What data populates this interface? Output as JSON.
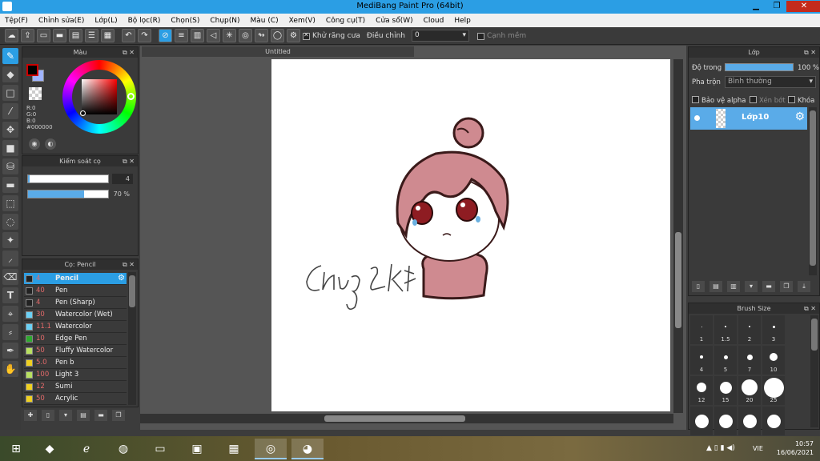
{
  "window": {
    "title": "MediBang Paint Pro (64bit)",
    "minimize": "▁",
    "maximize": "❐",
    "close": "✕"
  },
  "menu": [
    "Tệp(F)",
    "Chỉnh sửa(E)",
    "Lớp(L)",
    "Bộ lọc(R)",
    "Chọn(S)",
    "Chụp(N)",
    "Màu (C)",
    "Xem(V)",
    "Công cụ(T)",
    "Cửa sổ(W)",
    "Cloud",
    "Help"
  ],
  "toolbar": {
    "antialias_label": "Khử răng cưa",
    "antialias_checked": true,
    "correction_label": "Điều chỉnh",
    "correction_value": "0",
    "smooth_label": "Cạnh mềm",
    "smooth_checked": false
  },
  "color_panel": {
    "title": "Màu",
    "r": "R:0",
    "g": "G:0",
    "b": "B:0",
    "hex": "#000000",
    "primary": "#000000",
    "secondary": "#a0b4ff"
  },
  "brush_control": {
    "title": "Kiểm soát cọ",
    "size_value": "4",
    "size_fill": 0.02,
    "opacity_value": "70 %",
    "opacity_fill": 0.7
  },
  "brush_list": {
    "title": "Cọ: Pencil",
    "items": [
      {
        "size": "4",
        "name": "Pencil",
        "color": "#222222",
        "selected": true
      },
      {
        "size": "40",
        "name": "Pen",
        "color": "#222222"
      },
      {
        "size": "4",
        "name": "Pen (Sharp)",
        "color": "#222222"
      },
      {
        "size": "30",
        "name": "Watercolor (Wet)",
        "color": "#6ad0f5"
      },
      {
        "size": "11.1",
        "name": "Watercolor",
        "color": "#6ad0f5"
      },
      {
        "size": "10",
        "name": "Edge Pen",
        "color": "#2ea82e"
      },
      {
        "size": "50",
        "name": "Fluffy Watercolor",
        "color": "#b8e060"
      },
      {
        "size": "5.0",
        "name": " Pen b",
        "color": "#f0d020"
      },
      {
        "size": "100",
        "name": "Light 3",
        "color": "#b8e060"
      },
      {
        "size": "12",
        "name": "Sumi",
        "color": "#f0d020"
      },
      {
        "size": "50",
        "name": "Acrylic",
        "color": "#f0d020"
      }
    ]
  },
  "canvas": {
    "tab": "Untitled"
  },
  "layers": {
    "title": "Lớp",
    "opacity_label": "Độ trong",
    "opacity_value": "100 %",
    "blend_label": "Pha trộn",
    "blend_value": "Bình thường",
    "protect_alpha": "Bảo vệ alpha",
    "clip": "Xén bớt",
    "lock": "Khóa",
    "layer_name": "Lớp10"
  },
  "brush_size": {
    "title": "Brush Size",
    "sizes": [
      "1",
      "1.5",
      "2",
      "3",
      "4",
      "5",
      "7",
      "10",
      "12",
      "15",
      "20",
      "25",
      "",
      "",
      "",
      ""
    ]
  },
  "taskbar": {
    "lang": "VIE",
    "time": "10:57",
    "date": "16/06/2021"
  },
  "signature_text": "Chung 2K7"
}
